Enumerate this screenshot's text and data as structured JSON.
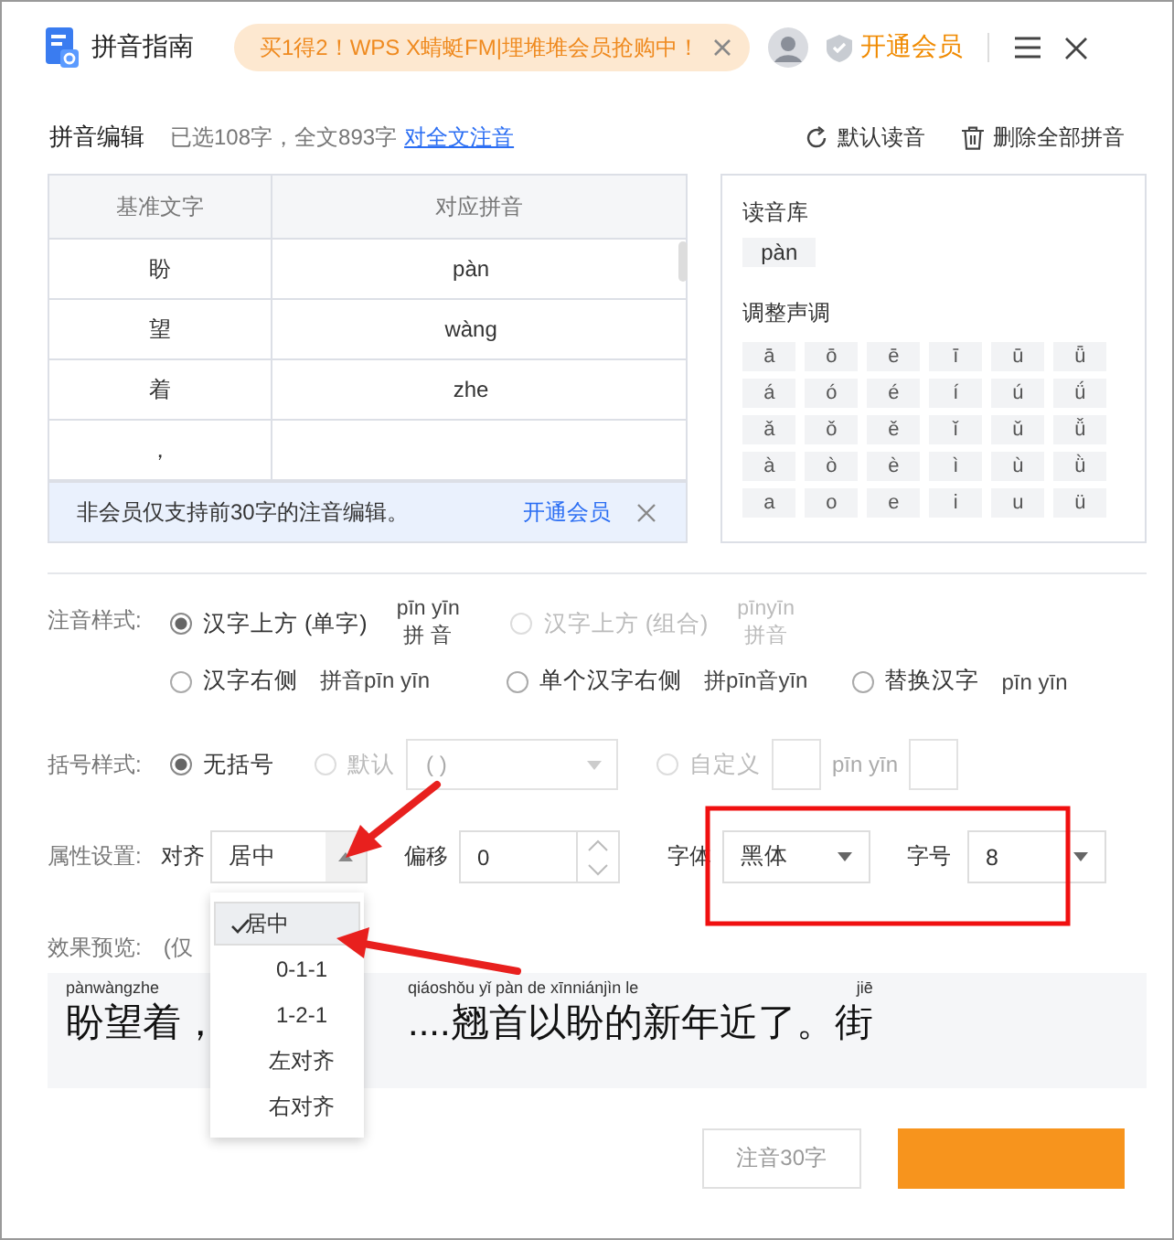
{
  "window": {
    "title": "拼音指南"
  },
  "promo": {
    "text": "买1得2！WPS X蜻蜓FM|埋堆堆会员抢购中！"
  },
  "header": {
    "vip_link": "开通会员"
  },
  "editor": {
    "title": "拼音编辑",
    "summary": "已选108字，全文893字",
    "link": "对全文注音",
    "actions": [
      {
        "kind": "reset",
        "label": "默认读音"
      },
      {
        "kind": "delete",
        "label": "删除全部拼音"
      }
    ]
  },
  "table": {
    "columns": [
      "基准文字",
      "对应拼音"
    ],
    "rows": [
      {
        "char": "盼",
        "pinyin": "pàn"
      },
      {
        "char": "望",
        "pinyin": "wàng"
      },
      {
        "char": "着",
        "pinyin": "zhe"
      },
      {
        "char": "，"
      }
    ]
  },
  "notice": {
    "text": "非会员仅支持前30字的注音编辑。",
    "link": "开通会员"
  },
  "reading_library": {
    "title": "读音库",
    "options": [
      "pàn"
    ]
  },
  "tones": {
    "title": "调整声调",
    "rows": [
      [
        "ā",
        "ō",
        "ē",
        "ī",
        "ū",
        "ǖ"
      ],
      [
        "á",
        "ó",
        "é",
        "í",
        "ú",
        "ǘ"
      ],
      [
        "ǎ",
        "ǒ",
        "ě",
        "ǐ",
        "ǔ",
        "ǚ"
      ],
      [
        "à",
        "ò",
        "è",
        "ì",
        "ù",
        "ǜ"
      ],
      [
        "a",
        "o",
        "e",
        "i",
        "u",
        "ü"
      ]
    ]
  },
  "annotation_style": {
    "label": "注音样式:",
    "rows": [
      [
        {
          "kind": "stacked",
          "label": "汉字上方 (单字)",
          "selected": true,
          "disabled": false,
          "sample_top": "pīn yīn",
          "sample_bottom": "拼 音"
        },
        {
          "kind": "stacked",
          "label": "汉字上方 (组合)",
          "selected": false,
          "disabled": true,
          "sample_top": "pīnyīn",
          "sample_bottom": "拼音"
        }
      ],
      [
        {
          "kind": "inline",
          "label": "汉字右侧",
          "selected": false,
          "disabled": false,
          "sample": "拼音pīn yīn"
        },
        {
          "kind": "inline",
          "label": "单个汉字右侧",
          "selected": false,
          "disabled": false,
          "sample": "拼pīn音yīn"
        },
        {
          "kind": "inline",
          "label": "替换汉字",
          "selected": false,
          "disabled": false,
          "sample": "pīn yīn"
        }
      ]
    ]
  },
  "bracket_style": {
    "label": "括号样式:",
    "options": [
      {
        "kind": "plain",
        "label": "无括号",
        "selected": true,
        "disabled": false
      },
      {
        "kind": "select",
        "label": "默认",
        "selected": false,
        "disabled": true,
        "value": "( )"
      },
      {
        "kind": "custom",
        "label": "自定义",
        "selected": false,
        "disabled": true,
        "sample": "pīn yīn"
      }
    ]
  },
  "properties": {
    "label": "属性设置:",
    "align": {
      "label": "对齐",
      "value": "居中",
      "expanded": true,
      "options": [
        {
          "label": "居中",
          "selected": true
        },
        {
          "label": "0-1-1",
          "selected": false
        },
        {
          "label": "1-2-1",
          "selected": false
        },
        {
          "label": "左对齐",
          "selected": false
        },
        {
          "label": "右对齐",
          "selected": false
        }
      ]
    },
    "offset": {
      "label": "偏移",
      "value": "0"
    },
    "font": {
      "label": "字体",
      "value": "黑体"
    },
    "size": {
      "label": "字号",
      "value": "8"
    }
  },
  "preview": {
    "label": "效果预览:",
    "note": "(仅",
    "left": {
      "pinyin": [
        "pànwàngzhe"
      ],
      "text": "盼望着，"
    },
    "right": {
      "pinyin": [
        "qiáoshǒu yǐ pàn de xīnniánjìn le",
        "jiē"
      ],
      "text": "....翘首以盼的新年近了。街"
    }
  },
  "footer": {
    "buttons": [
      {
        "kind": "secondary",
        "label": "注音30字"
      },
      {
        "kind": "primary"
      }
    ]
  }
}
